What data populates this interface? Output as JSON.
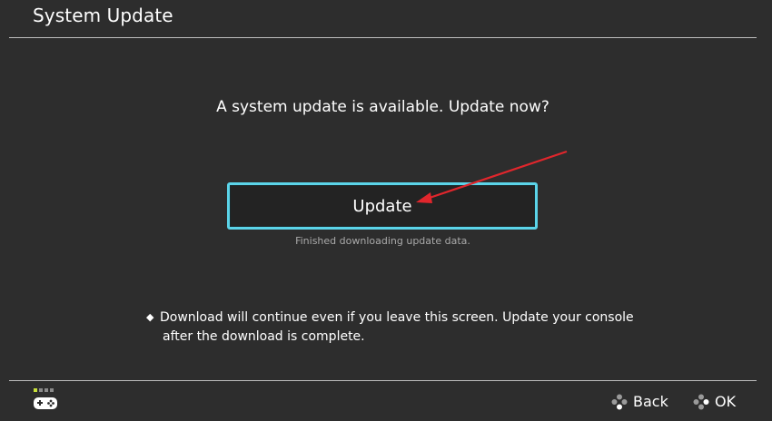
{
  "header": {
    "title": "System Update"
  },
  "main": {
    "prompt": "A system update is available. Update now?",
    "update_button_label": "Update",
    "status": "Finished downloading update data.",
    "note_line1": "Download will continue even if you leave this screen. Update your console",
    "note_line2": "after the download is complete."
  },
  "footer": {
    "controller_icon": "controller-icon",
    "back_label": "Back",
    "ok_label": "OK",
    "back_icon": "button-cluster-icon",
    "ok_icon": "button-cluster-icon"
  },
  "colors": {
    "background": "#2d2d2d",
    "accent": "#5bd4e9",
    "annotation_arrow": "#e0262c"
  }
}
